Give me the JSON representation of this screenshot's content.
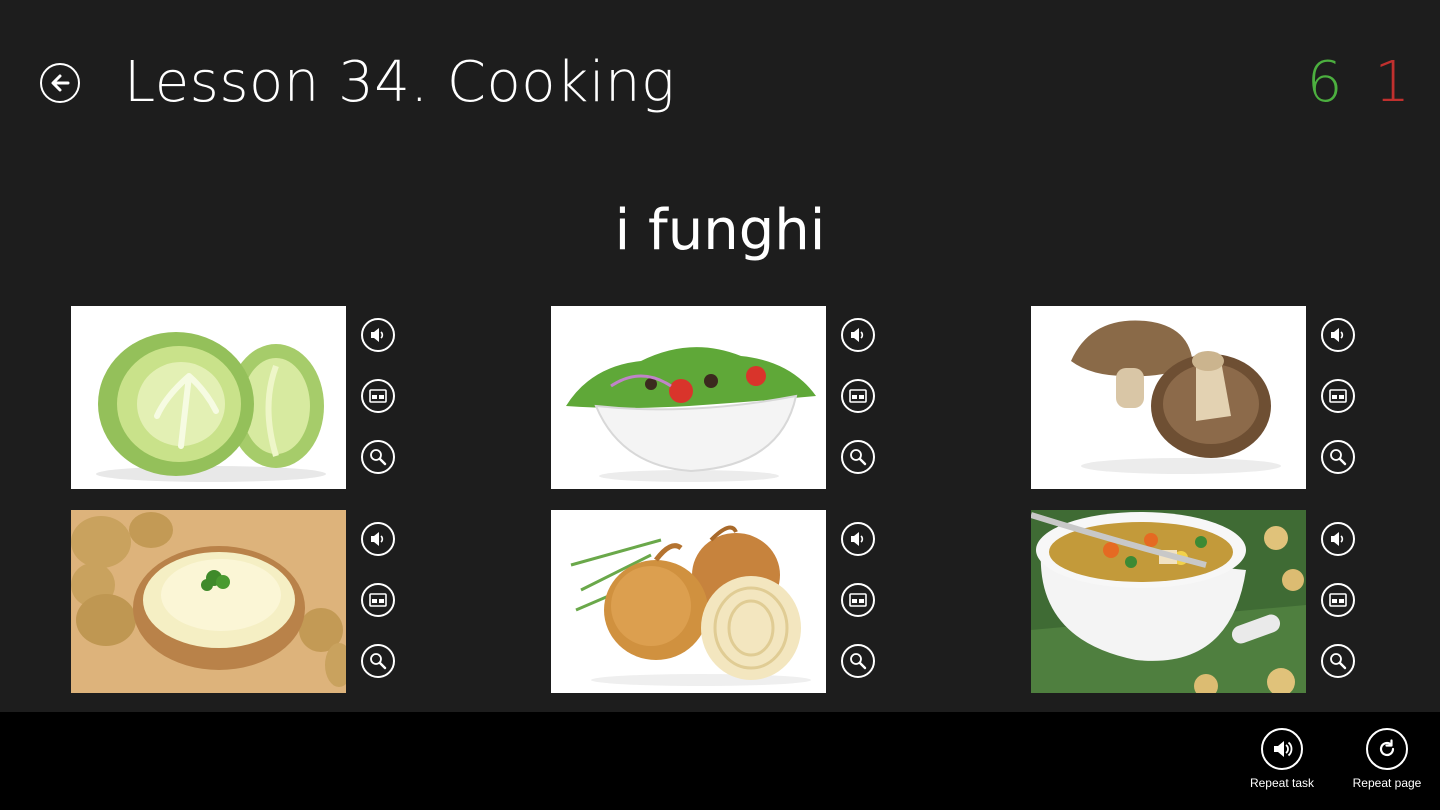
{
  "header": {
    "title": "Lesson 34. Cooking",
    "score_correct": "6",
    "score_wrong": "1"
  },
  "task": {
    "word": "i funghi"
  },
  "cards": [
    {
      "subject": "cabbage"
    },
    {
      "subject": "salad"
    },
    {
      "subject": "mushrooms"
    },
    {
      "subject": "mashed potatoes"
    },
    {
      "subject": "onions"
    },
    {
      "subject": "soup"
    }
  ],
  "card_actions": [
    "speaker-icon",
    "card-icon",
    "magnifier-icon"
  ],
  "bottom_bar": {
    "repeat_task_label": "Repeat task",
    "repeat_page_label": "Repeat page"
  },
  "colors": {
    "background": "#1d1d1d",
    "bottom_bar": "#000000",
    "correct": "#4caf3f",
    "wrong": "#c0302e"
  }
}
